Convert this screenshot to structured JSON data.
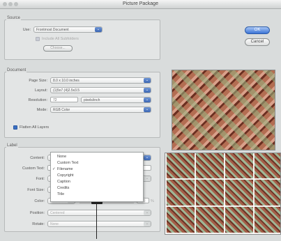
{
  "window": {
    "title": "Picture Package"
  },
  "source": {
    "legend": "Source",
    "use_label": "Use:",
    "use_value": "Frontmost Document",
    "include_subfolders": "Include All Subfolders",
    "choose_label": "Choose..."
  },
  "buttons": {
    "ok": "OK",
    "cancel": "Cancel"
  },
  "document": {
    "legend": "Document",
    "page_size_label": "Page Size:",
    "page_size_value": "8.0 x 10.0 inches",
    "layout_label": "Layout:",
    "layout_value": "(1)5x7 (4)2.5x3.5",
    "resolution_label": "Resolution:",
    "resolution_value": "72",
    "resolution_unit": "pixels/inch",
    "mode_label": "Mode:",
    "mode_value": "RGB Color",
    "flatten_label": "Flatten All Layers"
  },
  "label": {
    "legend": "Label",
    "content_label": "Content:",
    "custom_text_label": "Custom Text:",
    "font_label": "Font:",
    "font_size_label": "Font Size:",
    "color_label": "Color:",
    "opacity_value": "100",
    "opacity_unit": "%",
    "position_label": "Position:",
    "position_value": "Centered",
    "rotate_label": "Rotate:",
    "rotate_value": "None"
  },
  "content_menu": {
    "items": [
      "None",
      "Custom Text",
      "Filename",
      "Copyright",
      "Caption",
      "Credits",
      "Title"
    ],
    "checked_index": 2
  },
  "colors": {
    "accent": "#3b6fc2",
    "window_bg": "#d9dcdc"
  }
}
